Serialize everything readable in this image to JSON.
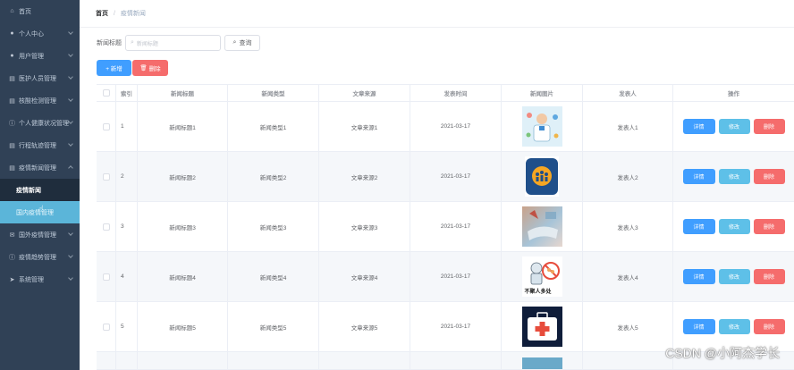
{
  "sidebar": {
    "items": [
      {
        "icon": "home-icon",
        "label": "首页",
        "chevron": false
      },
      {
        "icon": "user-icon",
        "label": "个人中心",
        "chevron": true
      },
      {
        "icon": "user-icon",
        "label": "用户管理",
        "chevron": true
      },
      {
        "icon": "document-icon",
        "label": "医护人员管理",
        "chevron": true
      },
      {
        "icon": "document-icon",
        "label": "核酸检测管理",
        "chevron": true
      },
      {
        "icon": "info-icon",
        "label": "个人健康状况管理",
        "chevron": true
      },
      {
        "icon": "document-icon",
        "label": "行程轨迹管理",
        "chevron": true
      },
      {
        "icon": "document-icon",
        "label": "疫情新闻管理",
        "chevron": true
      }
    ],
    "sub_active": "疫情新闻",
    "sub_hover": "国内疫情管理",
    "items_after": [
      {
        "icon": "mail-icon",
        "label": "国外疫情管理",
        "chevron": true
      },
      {
        "icon": "info-icon",
        "label": "疫情趋势管理",
        "chevron": true
      },
      {
        "icon": "send-icon",
        "label": "系统管理",
        "chevron": true
      }
    ]
  },
  "breadcrumb": {
    "home": "首页",
    "separator": "/",
    "current": "疫情新闻"
  },
  "search": {
    "label": "新闻标题",
    "placeholder": "新闻标题",
    "query_button": "查询"
  },
  "toolbar": {
    "add_label": "+ 新增",
    "delete_label": "删除"
  },
  "table": {
    "columns": [
      "索引",
      "新闻标题",
      "新闻类型",
      "文章来源",
      "发表时间",
      "新闻图片",
      "发表人",
      "操作"
    ],
    "rows": [
      {
        "index": "1",
        "title": "新闻标题1",
        "type": "新闻类型1",
        "source": "文章来源1",
        "time": "2021-03-17",
        "author": "发表人1",
        "image": "medical-staff-illustration"
      },
      {
        "index": "2",
        "title": "新闻标题2",
        "type": "新闻类型2",
        "source": "文章来源2",
        "time": "2021-03-17",
        "author": "发表人2",
        "image": "community-logo"
      },
      {
        "index": "3",
        "title": "新闻标题3",
        "type": "新闻类型3",
        "source": "文章来源3",
        "time": "2021-03-17",
        "author": "发表人3",
        "image": "mask-photo"
      },
      {
        "index": "4",
        "title": "新闻标题4",
        "type": "新闻类型4",
        "source": "文章来源4",
        "time": "2021-03-17",
        "author": "发表人4",
        "image": "no-gathering-poster",
        "image_caption": "不聚人多处"
      },
      {
        "index": "5",
        "title": "新闻标题5",
        "type": "新闻类型5",
        "source": "文章来源5",
        "time": "2021-03-17",
        "author": "发表人5",
        "image": "first-aid-kit"
      }
    ],
    "actions": {
      "detail": "详情",
      "edit": "修改",
      "delete": "删除"
    }
  },
  "watermark": "CSDN @小阿杰学长",
  "colors": {
    "sidebar_bg": "#304156",
    "primary": "#409eff",
    "info": "#5ec0e8",
    "danger": "#f56c6c",
    "hover": "#5bb5d9"
  }
}
